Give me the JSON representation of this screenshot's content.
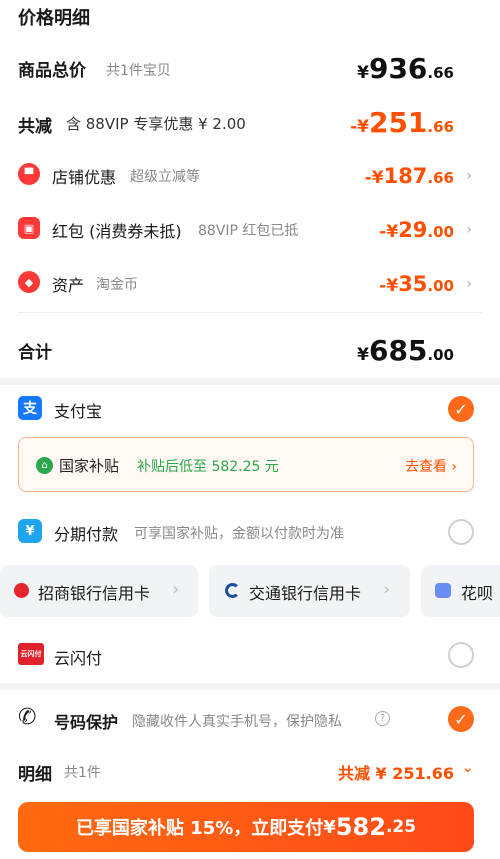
{
  "title": "价格明细",
  "goods": {
    "label": "商品总价",
    "sub": "共1件宝贝",
    "yen": "¥",
    "int": "936",
    "dec": ".66"
  },
  "reduce": {
    "label": "共减",
    "sub": "含 88VIP 专享优惠 ¥ 2.00",
    "prefix": "-",
    "yen": "¥",
    "int": "251",
    "dec": ".66"
  },
  "store": {
    "label": "店铺优惠",
    "sub": "超级立减等",
    "prefix": "-",
    "yen": "¥",
    "int": "187",
    "dec": ".66"
  },
  "redpack": {
    "label": "红包 (消费券未抵)",
    "sub": "88VIP 红包已抵",
    "prefix": "-",
    "yen": "¥",
    "int": "29",
    "dec": ".00"
  },
  "assets": {
    "label": "资产",
    "sub": "淘金币",
    "prefix": "-",
    "yen": "¥",
    "int": "35",
    "dec": ".00"
  },
  "total": {
    "label": "合计",
    "yen": "¥",
    "int": "685",
    "dec": ".00"
  },
  "alipay": {
    "label": "支付宝",
    "icon_char": "支"
  },
  "subsidy": {
    "label": "国家补贴",
    "desc": "补贴后低至 582.25 元",
    "link": "去查看 ›"
  },
  "installment": {
    "label": "分期付款",
    "desc": "可享国家补贴，金额以付款时为准",
    "icon_char": "¥"
  },
  "cards": [
    {
      "label": "招商银行信用卡"
    },
    {
      "label": "交通银行信用卡"
    },
    {
      "label": "花呗"
    }
  ],
  "unionpay": {
    "label": "云闪付",
    "icon_text": "云闪付"
  },
  "phone_protect": {
    "label": "号码保护",
    "desc": "隐藏收件人真实手机号，保护隐私"
  },
  "detail": {
    "label": "明细",
    "sub": "共1件",
    "reduce_text": "共减 ¥ 251.66"
  },
  "pay_button": {
    "text": "已享国家补贴 15%，立即支付",
    "yen": "¥",
    "int": "582",
    "dec": ".25"
  },
  "colors": {
    "accent": "#ff5000",
    "green": "#2aa84a"
  }
}
